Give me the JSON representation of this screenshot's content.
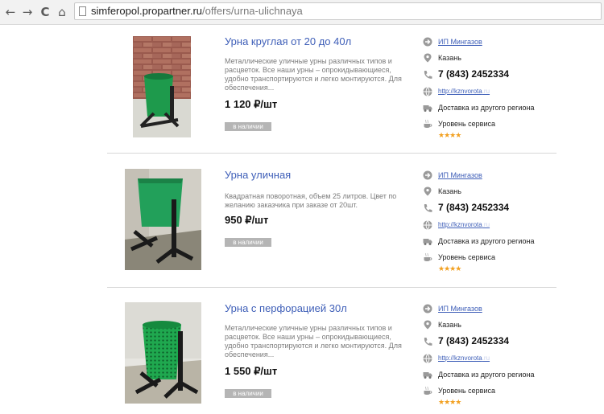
{
  "browser": {
    "back": "←",
    "forward": "→",
    "reload": "C",
    "home": "⌂",
    "url_host": "simferopol.propartner.ru",
    "url_path": "/offers/urna-ulichnaya"
  },
  "listings": [
    {
      "title": "Урна круглая от 20 до 40л",
      "description": "Металлические уличные урны различных типов и расцветок. Все наши урны – опрокидывающиеся, удобно транспортируются и легко монтируются. Для обеспечения...",
      "price": "1 120 ₽/шт",
      "stock": "в наличии",
      "seller": "ИП Мингазов",
      "city": "Казань",
      "phone": "7 (843) 2452334",
      "site": "http://kznvorota",
      "site_tail": ".ru",
      "delivery": "Доставка из другого региона",
      "service": "Уровень сервиса",
      "stars": "★★★★"
    },
    {
      "title": "Урна уличная",
      "description": " Квадратная поворотная, объем 25 литров. Цвет по желанию заказчика при заказе от 20шт.",
      "price": "950 ₽/шт",
      "stock": "в наличии",
      "seller": "ИП Мингазов",
      "city": "Казань",
      "phone": "7 (843) 2452334",
      "site": "http://kznvorota",
      "site_tail": ".ru",
      "delivery": "Доставка из другого региона",
      "service": "Уровень сервиса",
      "stars": "★★★★"
    },
    {
      "title": "Урна с перфорацией 30л",
      "description": "Металлические уличные урны различных типов и расцветок. Все наши урны – опрокидывающиеся, удобно транспортируются и легко монтируются. Для обеспечения...",
      "price": "1 550 ₽/шт",
      "stock": "в наличии",
      "seller": "ИП Мингазов",
      "city": "Казань",
      "phone": "7 (843) 2452334",
      "site": "http://kznvorota",
      "site_tail": ".ru",
      "delivery": "Доставка из другого региона",
      "service": "Уровень сервиса",
      "stars": "★★★★"
    }
  ],
  "colors": {
    "link": "#3f5fb8",
    "badge": "#b5b5b5",
    "star": "#f2a020",
    "product_green": "#1e9a4c"
  }
}
